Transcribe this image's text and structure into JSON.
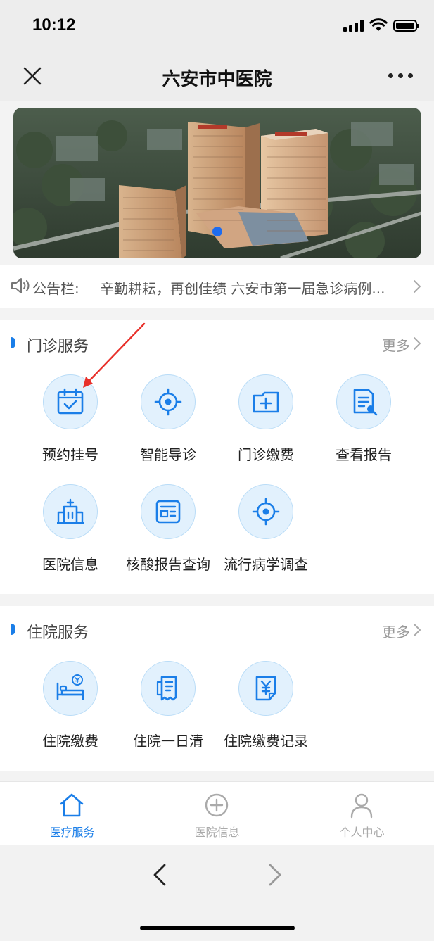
{
  "status_bar": {
    "time": "10:12"
  },
  "nav": {
    "title": "六安市中医院"
  },
  "notice": {
    "label": "公告栏:",
    "text": "辛勤耕耘，再创佳绩 六安市第一届急诊病例..."
  },
  "outpatient": {
    "title": "门诊服务",
    "more": "更多",
    "items": [
      {
        "label": "预约挂号",
        "icon": "calendar-check-icon"
      },
      {
        "label": "智能导诊",
        "icon": "target-icon"
      },
      {
        "label": "门诊缴费",
        "icon": "wallet-plus-icon"
      },
      {
        "label": "查看报告",
        "icon": "report-search-icon"
      },
      {
        "label": "医院信息",
        "icon": "hospital-building-icon"
      },
      {
        "label": "核酸报告查询",
        "icon": "form-list-icon"
      },
      {
        "label": "流行病学调查",
        "icon": "target-icon"
      }
    ]
  },
  "inpatient": {
    "title": "住院服务",
    "more": "更多",
    "items": [
      {
        "label": "住院缴费",
        "icon": "bed-yuan-icon"
      },
      {
        "label": "住院一日清",
        "icon": "receipt-icon"
      },
      {
        "label": "住院缴费记录",
        "icon": "yuan-document-icon"
      }
    ]
  },
  "tabbar": {
    "tabs": [
      {
        "label": "医疗服务",
        "icon": "home-icon",
        "active": true
      },
      {
        "label": "医院信息",
        "icon": "plus-circle-icon",
        "active": false
      },
      {
        "label": "个人中心",
        "icon": "person-icon",
        "active": false
      }
    ]
  },
  "colors": {
    "accent": "#1a7ee8",
    "icon_bg": "#e2f1fd",
    "annotation_arrow": "#e8302a"
  }
}
